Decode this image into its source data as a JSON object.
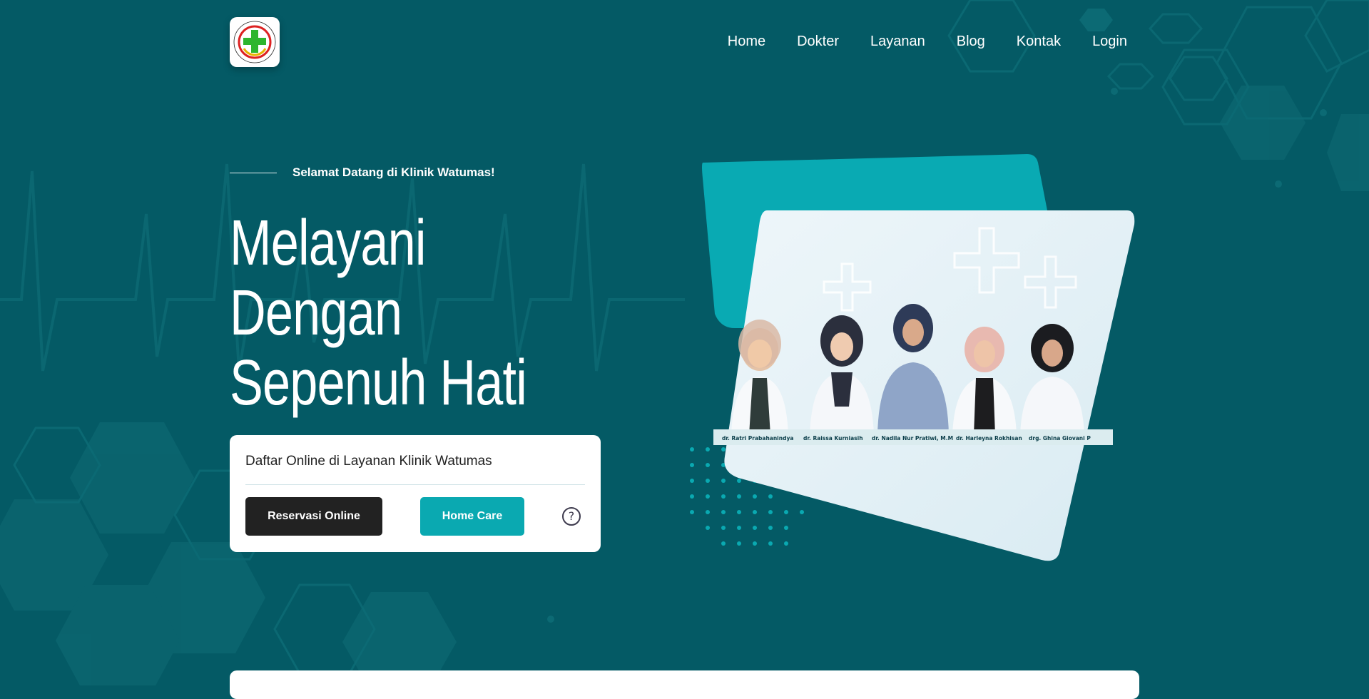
{
  "navbar": {
    "logo_alt": "Klinik Pratama Rawat Jalan Watumas",
    "logo_text_top": "KLINIK PRATAMA RAWAT JALAN",
    "logo_text_bottom": "WATUMAS",
    "links": [
      "Home",
      "Dokter",
      "Layanan",
      "Blog",
      "Kontak",
      "Login"
    ]
  },
  "hero": {
    "welcome": "Selamat Datang di Klinik Watumas!",
    "title_lines": [
      "Melayani",
      "Dengan",
      "Sepenuh Hati"
    ]
  },
  "reservation": {
    "title": "Daftar Online di Layanan Klinik Watumas",
    "primary_button": "Reservasi Online",
    "secondary_button": "Home Care",
    "help_icon": "question-circle-icon"
  },
  "doctors": [
    "dr. Ratri Prabahanindya",
    "dr. Raissa Kurniasih",
    "dr. Nadila Nur Pratiwi, M.M",
    "dr. Harleyna Rokhisan",
    "drg. Ghina Giovani P"
  ],
  "colors": {
    "background": "#045a65",
    "accent": "#0aa9b1",
    "dark_button": "#222222",
    "card": "#ffffff"
  }
}
